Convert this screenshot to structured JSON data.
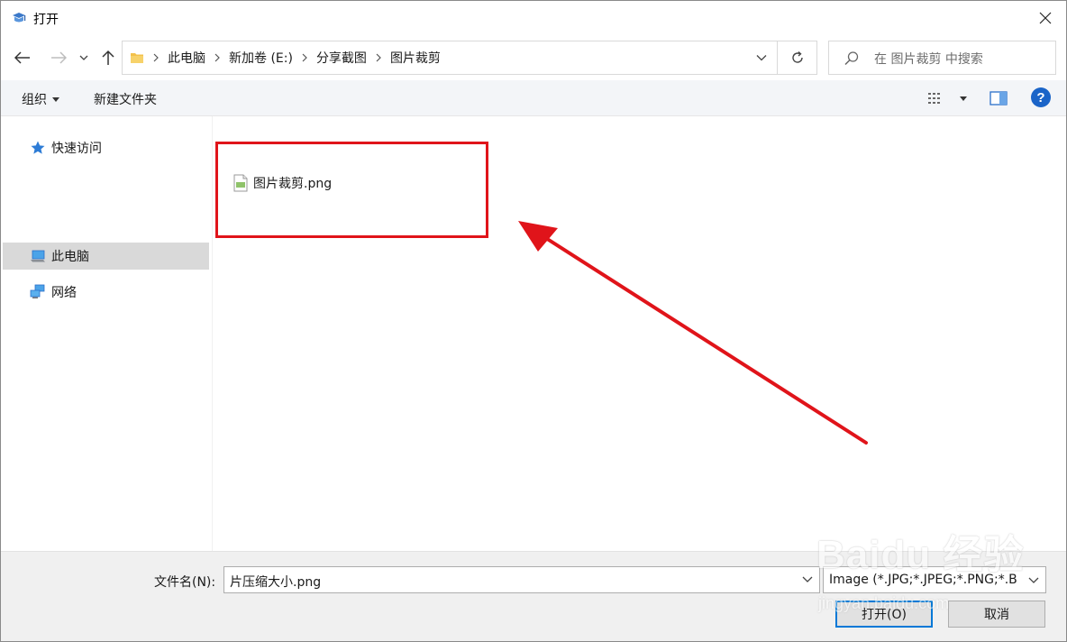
{
  "window": {
    "title": "打开"
  },
  "nav": {
    "breadcrumbs": [
      "此电脑",
      "新加卷 (E:)",
      "分享截图",
      "图片裁剪"
    ],
    "search_placeholder": "在 图片裁剪 中搜索"
  },
  "toolbar": {
    "organize_label": "组织",
    "new_folder_label": "新建文件夹",
    "help_label": "?"
  },
  "sidebar": {
    "items": [
      {
        "label": "快速访问",
        "icon": "star-icon",
        "selected": false
      },
      {
        "label": "此电脑",
        "icon": "computer-icon",
        "selected": true
      },
      {
        "label": "网络",
        "icon": "network-icon",
        "selected": false
      }
    ]
  },
  "files": [
    {
      "name": "图片裁剪.png",
      "icon": "image-file-icon"
    }
  ],
  "footer": {
    "filename_label": "文件名(N):",
    "filename_value": "片压缩大小.png",
    "filetype_value": "Image (*.JPG;*.JPEG;*.PNG;*.B",
    "open_label": "打开(O)",
    "cancel_label": "取消"
  },
  "annotation": {
    "color": "#e0141a"
  },
  "watermark": {
    "text": "Baidu 经验",
    "url": "jingyan.baidu.com"
  }
}
